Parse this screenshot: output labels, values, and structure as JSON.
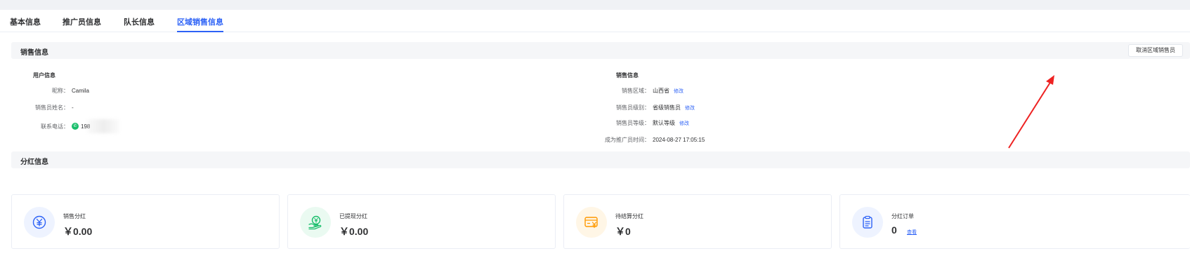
{
  "tabs": [
    {
      "label": "基本信息",
      "active": false
    },
    {
      "label": "推广员信息",
      "active": false
    },
    {
      "label": "队长信息",
      "active": false
    },
    {
      "label": "区域销售信息",
      "active": true
    }
  ],
  "sales_section": {
    "title": "销售信息",
    "cancel_button": "取消区域销售员"
  },
  "user_info": {
    "title": "用户信息",
    "rows": [
      {
        "label": "昵称：",
        "value": "Camila"
      },
      {
        "label": "销售员姓名：",
        "value": "-"
      },
      {
        "label": "联系电话：",
        "value": "198"
      }
    ]
  },
  "sales_info": {
    "title": "销售信息",
    "rows": [
      {
        "label": "销售区域：",
        "value": "山西省",
        "edit": "修改"
      },
      {
        "label": "销售员级别：",
        "value": "省级销售员",
        "edit": "修改"
      },
      {
        "label": "销售员等级：",
        "value": "默认等级",
        "edit": "修改"
      },
      {
        "label": "成为推广员时间：",
        "value": "2024-08-27 17:05:15"
      }
    ]
  },
  "dividend_section": {
    "title": "分红信息"
  },
  "cards": [
    {
      "label": "销售分红",
      "value": "￥0.00",
      "icon": "yen-coin-icon",
      "color": "#2d62f6",
      "bg": "#eef3ff"
    },
    {
      "label": "已提现分红",
      "value": "￥0.00",
      "icon": "hand-coin-icon",
      "color": "#19be6b",
      "bg": "#eafaf1"
    },
    {
      "label": "待结算分红",
      "value": "￥0",
      "icon": "card-yen-icon",
      "color": "#ff9900",
      "bg": "#fff6e6"
    },
    {
      "label": "分红订单",
      "value": "0",
      "icon": "clipboard-icon",
      "color": "#2d62f6",
      "bg": "#eef3ff",
      "view": "查看"
    }
  ],
  "annotation_color": "#ee2222"
}
